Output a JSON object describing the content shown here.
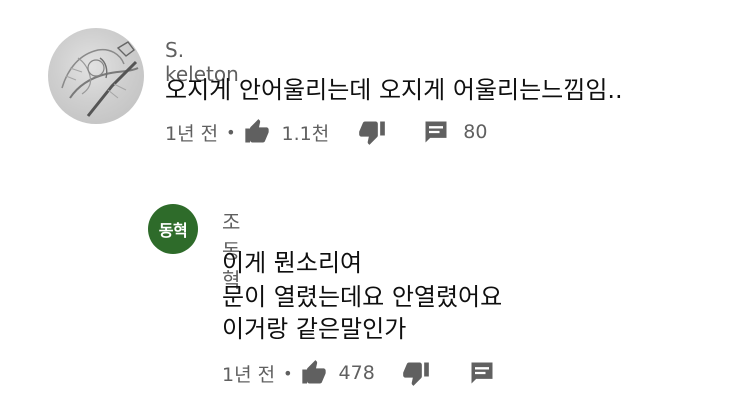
{
  "comment": {
    "author": "S. keleton",
    "text": "오지게 안어울리는데 오지게 어울리는느낌임..",
    "time": "1년 전",
    "likes": "1.1천",
    "replies": "80"
  },
  "reply": {
    "avatar_text": "동혁",
    "author": "조동혁",
    "lines": [
      "이게 뭔소리여",
      "문이 열렸는데요 안열렸어요",
      "이거랑 같은말인가"
    ],
    "time": "1년 전",
    "likes": "478"
  },
  "icons": {
    "like": "thumbs-up-icon",
    "dislike": "thumbs-down-icon",
    "reply": "comment-icon"
  },
  "colors": {
    "reply_avatar_bg": "#2e6b2a",
    "secondary_text": "#606060",
    "primary_text": "#0f0f0f"
  }
}
